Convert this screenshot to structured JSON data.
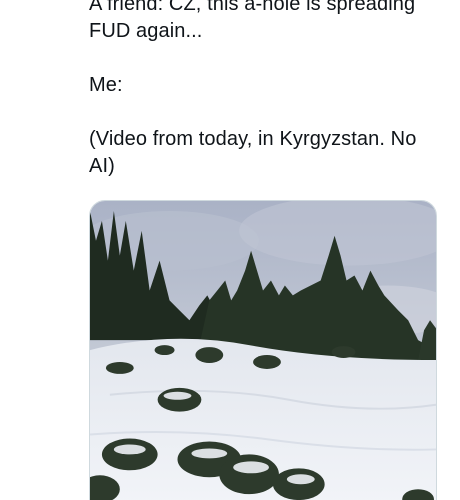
{
  "tweet": {
    "lines": [
      "A friend: CZ, this a-hole is spreading",
      "FUD again...",
      "Me:",
      "(Video from today, in Kyrgyzstan. No",
      "AI)"
    ]
  },
  "media": {
    "kind": "video",
    "scene": "snowy-forest",
    "colors": {
      "sky": "#9aa3ba",
      "snow": "#eef1f6",
      "trees": "#243224"
    }
  }
}
